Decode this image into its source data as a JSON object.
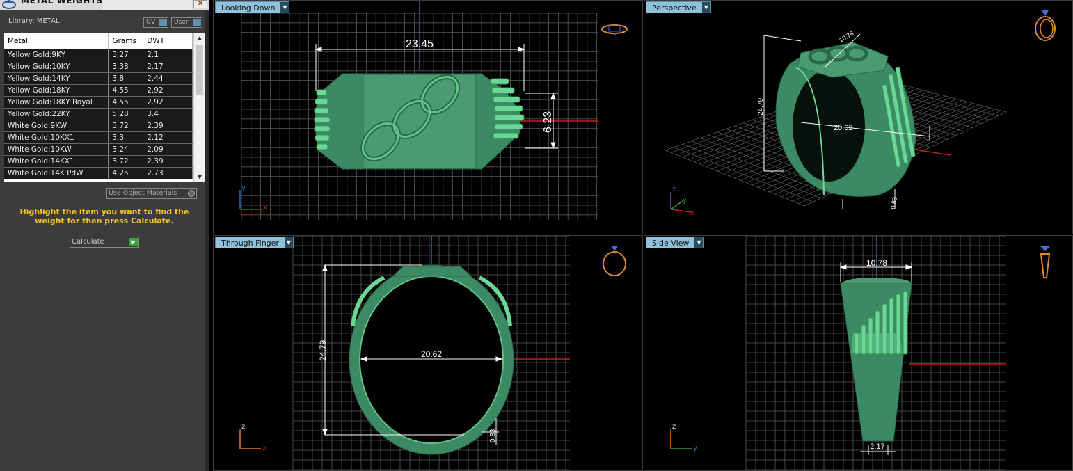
{
  "panel": {
    "title": "METAL WEIGHTS",
    "close_icon": "close-icon",
    "library_label": "Library: METAL",
    "gv_label": "GV",
    "user_label": "User",
    "table": {
      "headers": [
        "Metal",
        "Grams",
        "DWT"
      ],
      "rows": [
        [
          "Yellow Gold:9KY",
          "3.27",
          "2.1"
        ],
        [
          "Yellow Gold:10KY",
          "3.38",
          "2.17"
        ],
        [
          "Yellow Gold:14KY",
          "3.8",
          "2.44"
        ],
        [
          "Yellow Gold:18KY",
          "4.55",
          "2.92"
        ],
        [
          "Yellow Gold:18KY Royal",
          "4.55",
          "2.92"
        ],
        [
          "Yellow Gold:22KY",
          "5.28",
          "3.4"
        ],
        [
          "White Gold:9KW",
          "3.72",
          "2.39"
        ],
        [
          "White Gold:10KX1",
          "3.3",
          "2.12"
        ],
        [
          "White Gold:10KW",
          "3.24",
          "2.09"
        ],
        [
          "White Gold:14KX1",
          "3.72",
          "2.39"
        ],
        [
          "White Gold:14K PdW",
          "4.25",
          "2.73"
        ]
      ]
    },
    "use_object_materials": "Use Object Materials",
    "instructions": "Highlight the item you want to find the weight for then press Calculate.",
    "calculate_label": "Calculate"
  },
  "viewports": {
    "top": {
      "label": "Looking Down",
      "width_dim": "23.45",
      "height_dim": "6.23",
      "axis_v": "y",
      "axis_h": "x"
    },
    "perspective": {
      "label": "Perspective",
      "dim_top": "10.78",
      "dim_height": "24.79",
      "dim_inner": "20.62",
      "dim_small": "0.83",
      "axis_v": "z",
      "axis_h": "y",
      "axis_d": "x"
    },
    "front": {
      "label": "Through Finger",
      "inner_dim": "20.62",
      "height_dim": "24.79",
      "thickness_dim": "0.83",
      "axis_v": "z",
      "axis_h": "x"
    },
    "side": {
      "label": "Side View",
      "top_dim": "10.78",
      "bottom_dim": "2.17",
      "axis_v": "z",
      "axis_h": "y"
    }
  },
  "colors": {
    "ring_fill": "#3b8a64",
    "ring_light": "#5fd08a",
    "grid": "#5a5a5a",
    "axis_red": "#c02020",
    "axis_blue": "#2a6aa8",
    "label_bg": "#8fc1dc",
    "warning_text": "#f2c230"
  }
}
